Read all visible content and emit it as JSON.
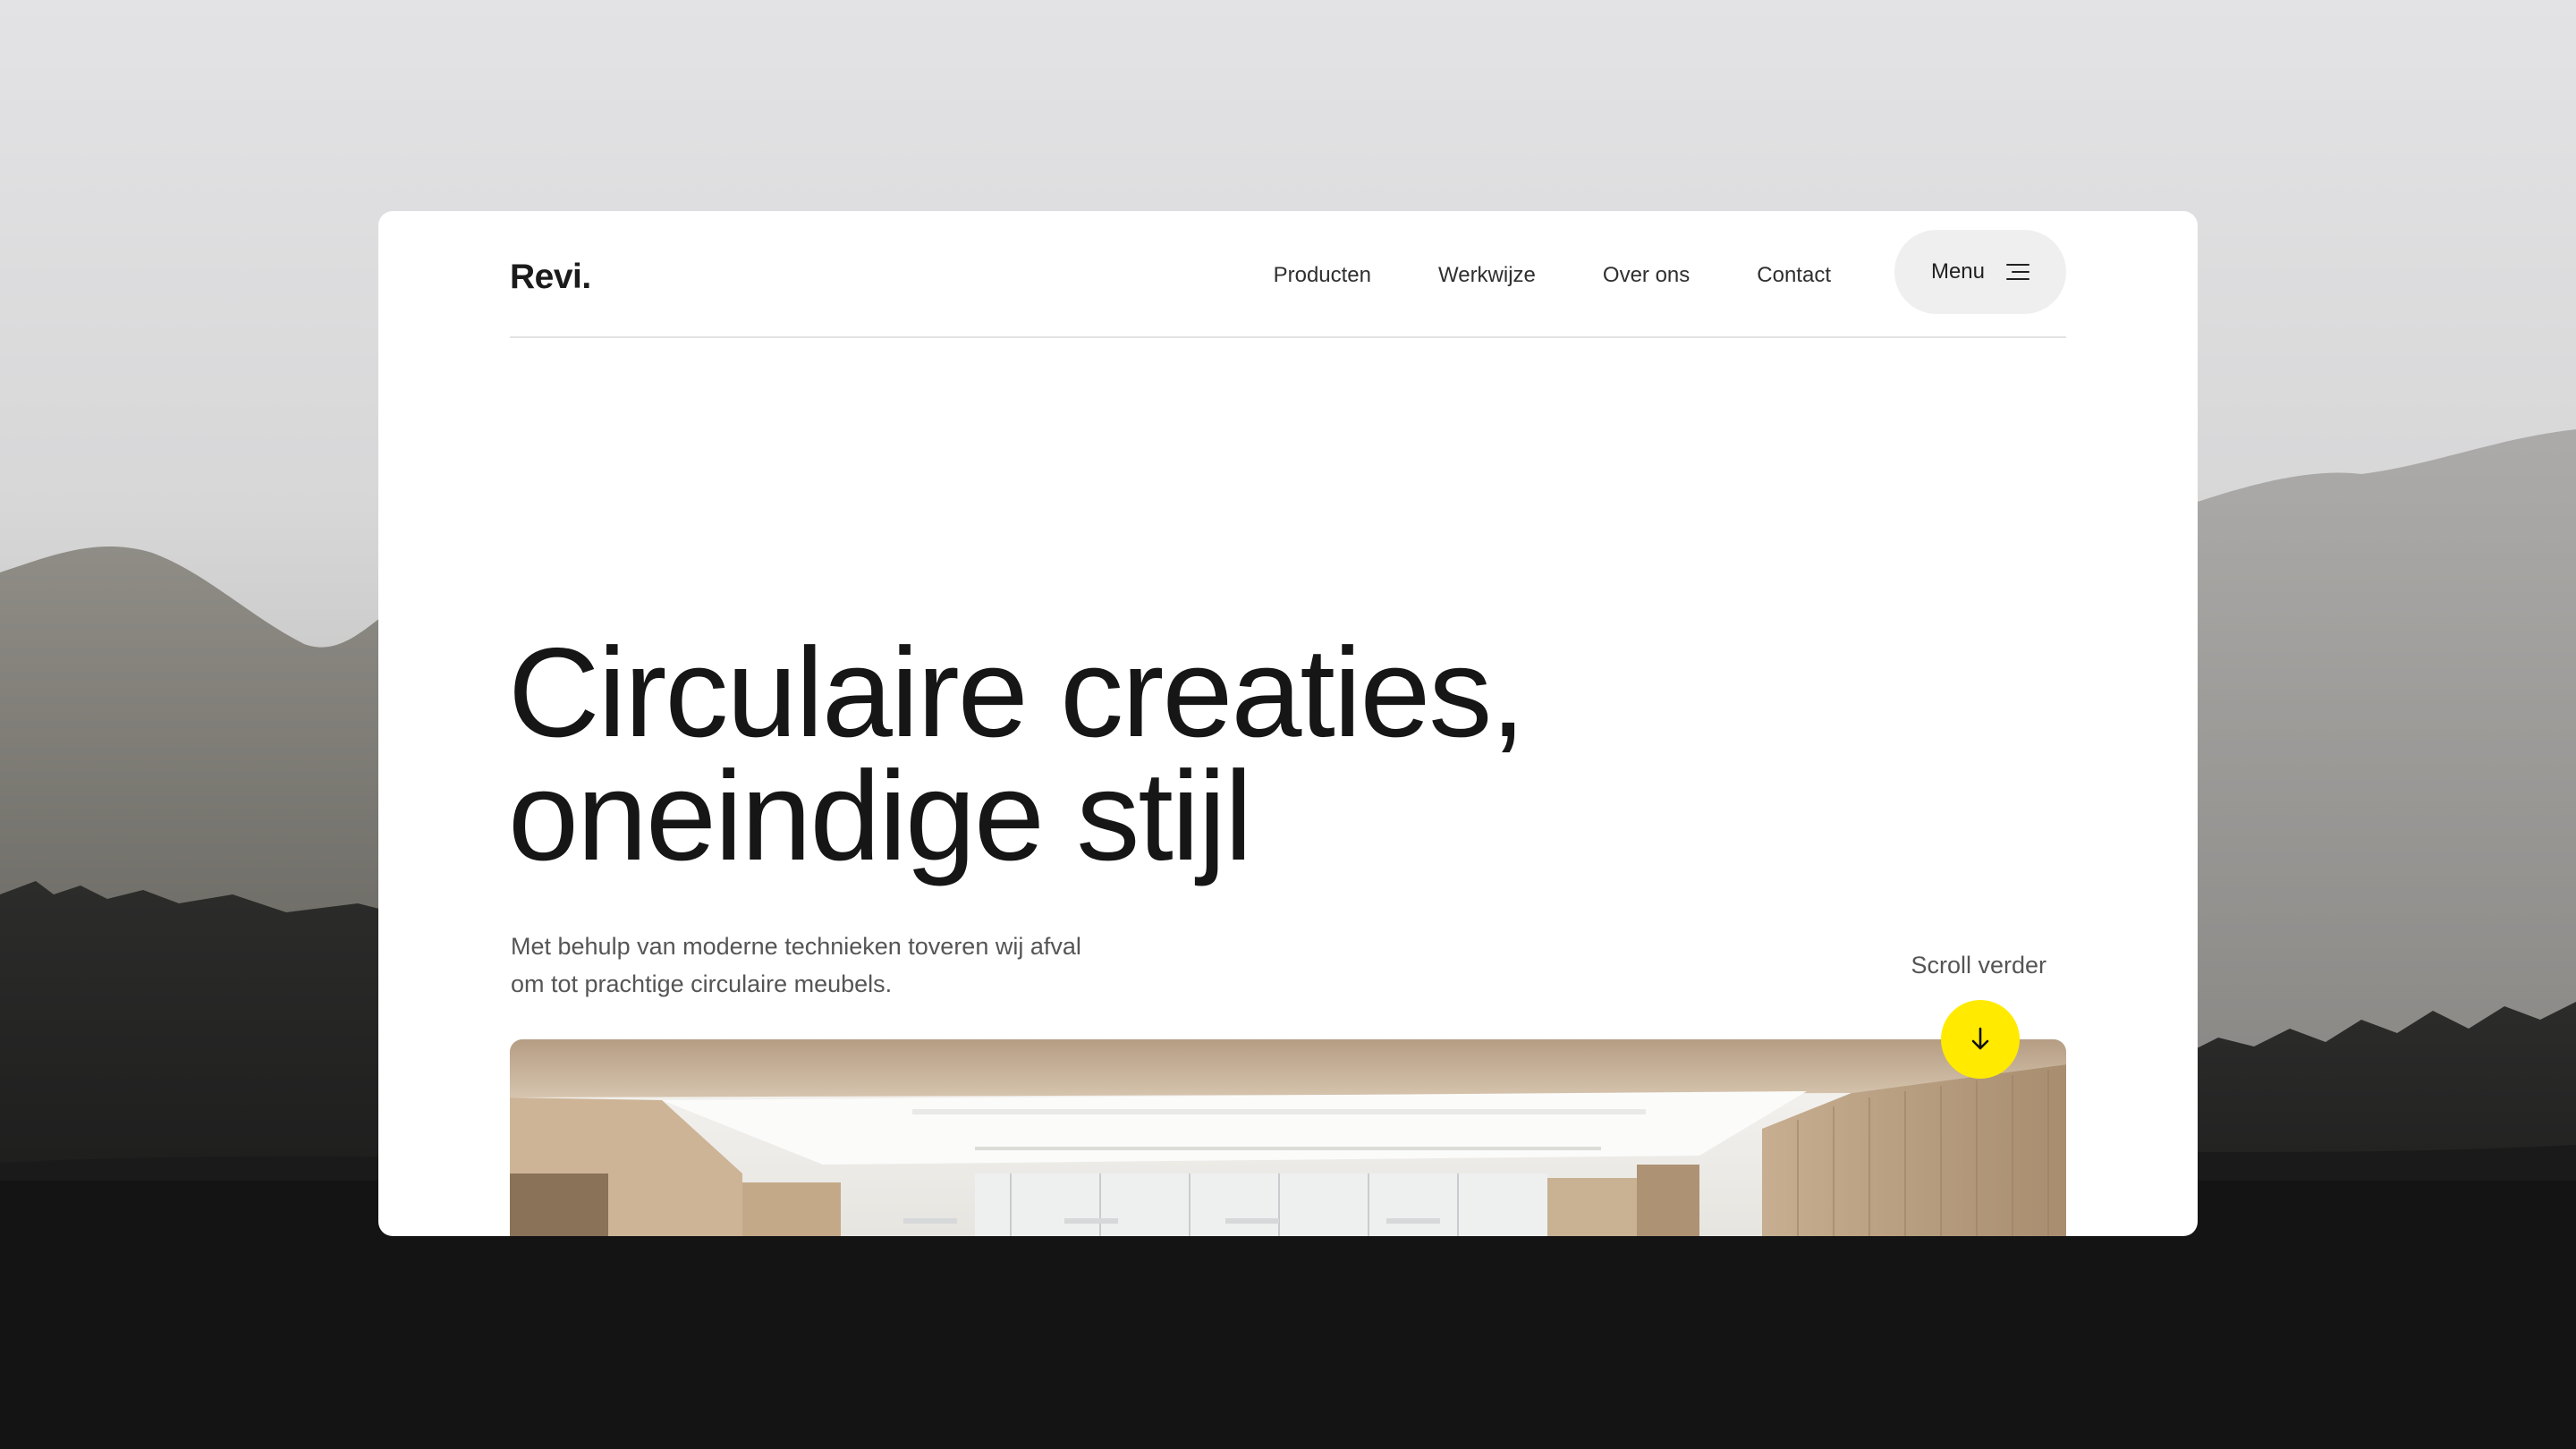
{
  "brand": {
    "logo": "Revi."
  },
  "nav": {
    "links": [
      "Producten",
      "Werkwijze",
      "Over ons",
      "Contact"
    ],
    "menu_label": "Menu"
  },
  "hero": {
    "title_line1": "Circulaire creaties,",
    "title_line2": "oneindige stijl",
    "subtitle": "Met behulp van moderne technieken toveren wij afval om tot prachtige circulaire meubels.",
    "scroll_label": "Scroll verder"
  },
  "icons": {
    "menu": "hamburger-icon",
    "scroll": "arrow-down-icon"
  },
  "colors": {
    "accent": "#ffea00",
    "text": "#161616",
    "card": "#ffffff",
    "menu_bg": "#efefef"
  }
}
